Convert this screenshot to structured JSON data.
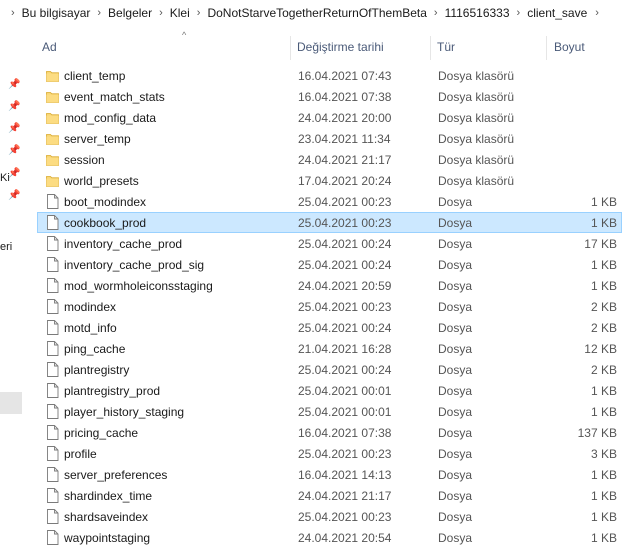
{
  "breadcrumb": {
    "items": [
      "Bu bilgisayar",
      "Belgeler",
      "Klei",
      "DoNotStarveTogetherReturnOfThemBeta",
      "1116516333",
      "client_save"
    ]
  },
  "navstrip": {
    "cut_labels": [
      "Ki",
      "eri"
    ]
  },
  "columns": {
    "name": "Ad",
    "date": "Değiştirme tarihi",
    "type": "Tür",
    "size": "Boyut"
  },
  "files": [
    {
      "name": "client_temp",
      "date": "16.04.2021 07:43",
      "type": "Dosya klasörü",
      "size": "",
      "icon": "folder-icon"
    },
    {
      "name": "event_match_stats",
      "date": "16.04.2021 07:38",
      "type": "Dosya klasörü",
      "size": "",
      "icon": "folder-icon"
    },
    {
      "name": "mod_config_data",
      "date": "24.04.2021 20:00",
      "type": "Dosya klasörü",
      "size": "",
      "icon": "folder-icon"
    },
    {
      "name": "server_temp",
      "date": "23.04.2021 11:34",
      "type": "Dosya klasörü",
      "size": "",
      "icon": "folder-icon"
    },
    {
      "name": "session",
      "date": "24.04.2021 21:17",
      "type": "Dosya klasörü",
      "size": "",
      "icon": "folder-icon"
    },
    {
      "name": "world_presets",
      "date": "17.04.2021 20:24",
      "type": "Dosya klasörü",
      "size": "",
      "icon": "folder-icon"
    },
    {
      "name": "boot_modindex",
      "date": "25.04.2021 00:23",
      "type": "Dosya",
      "size": "1 KB",
      "icon": "file-icon"
    },
    {
      "name": "cookbook_prod",
      "date": "25.04.2021 00:23",
      "type": "Dosya",
      "size": "1 KB",
      "icon": "file-icon",
      "selected": true
    },
    {
      "name": "inventory_cache_prod",
      "date": "25.04.2021 00:24",
      "type": "Dosya",
      "size": "17 KB",
      "icon": "file-icon"
    },
    {
      "name": "inventory_cache_prod_sig",
      "date": "25.04.2021 00:24",
      "type": "Dosya",
      "size": "1 KB",
      "icon": "file-icon"
    },
    {
      "name": "mod_wormholeiconsstaging",
      "date": "24.04.2021 20:59",
      "type": "Dosya",
      "size": "1 KB",
      "icon": "file-icon"
    },
    {
      "name": "modindex",
      "date": "25.04.2021 00:23",
      "type": "Dosya",
      "size": "2 KB",
      "icon": "file-icon"
    },
    {
      "name": "motd_info",
      "date": "25.04.2021 00:24",
      "type": "Dosya",
      "size": "2 KB",
      "icon": "file-icon"
    },
    {
      "name": "ping_cache",
      "date": "21.04.2021 16:28",
      "type": "Dosya",
      "size": "12 KB",
      "icon": "file-icon"
    },
    {
      "name": "plantregistry",
      "date": "25.04.2021 00:24",
      "type": "Dosya",
      "size": "2 KB",
      "icon": "file-icon"
    },
    {
      "name": "plantregistry_prod",
      "date": "25.04.2021 00:01",
      "type": "Dosya",
      "size": "1 KB",
      "icon": "file-icon"
    },
    {
      "name": "player_history_staging",
      "date": "25.04.2021 00:01",
      "type": "Dosya",
      "size": "1 KB",
      "icon": "file-icon"
    },
    {
      "name": "pricing_cache",
      "date": "16.04.2021 07:38",
      "type": "Dosya",
      "size": "137 KB",
      "icon": "file-icon"
    },
    {
      "name": "profile",
      "date": "25.04.2021 00:23",
      "type": "Dosya",
      "size": "3 KB",
      "icon": "file-icon"
    },
    {
      "name": "server_preferences",
      "date": "16.04.2021 14:13",
      "type": "Dosya",
      "size": "1 KB",
      "icon": "file-icon"
    },
    {
      "name": "shardindex_time",
      "date": "24.04.2021 21:17",
      "type": "Dosya",
      "size": "1 KB",
      "icon": "file-icon"
    },
    {
      "name": "shardsaveindex",
      "date": "25.04.2021 00:23",
      "type": "Dosya",
      "size": "1 KB",
      "icon": "file-icon"
    },
    {
      "name": "waypointstaging",
      "date": "24.04.2021 20:54",
      "type": "Dosya",
      "size": "1 KB",
      "icon": "file-icon"
    }
  ],
  "colors": {
    "selection_bg": "#cce8ff",
    "selection_border": "#99d1ff",
    "folder_yellow": "#f8d775",
    "header_text": "#4a5a78"
  }
}
